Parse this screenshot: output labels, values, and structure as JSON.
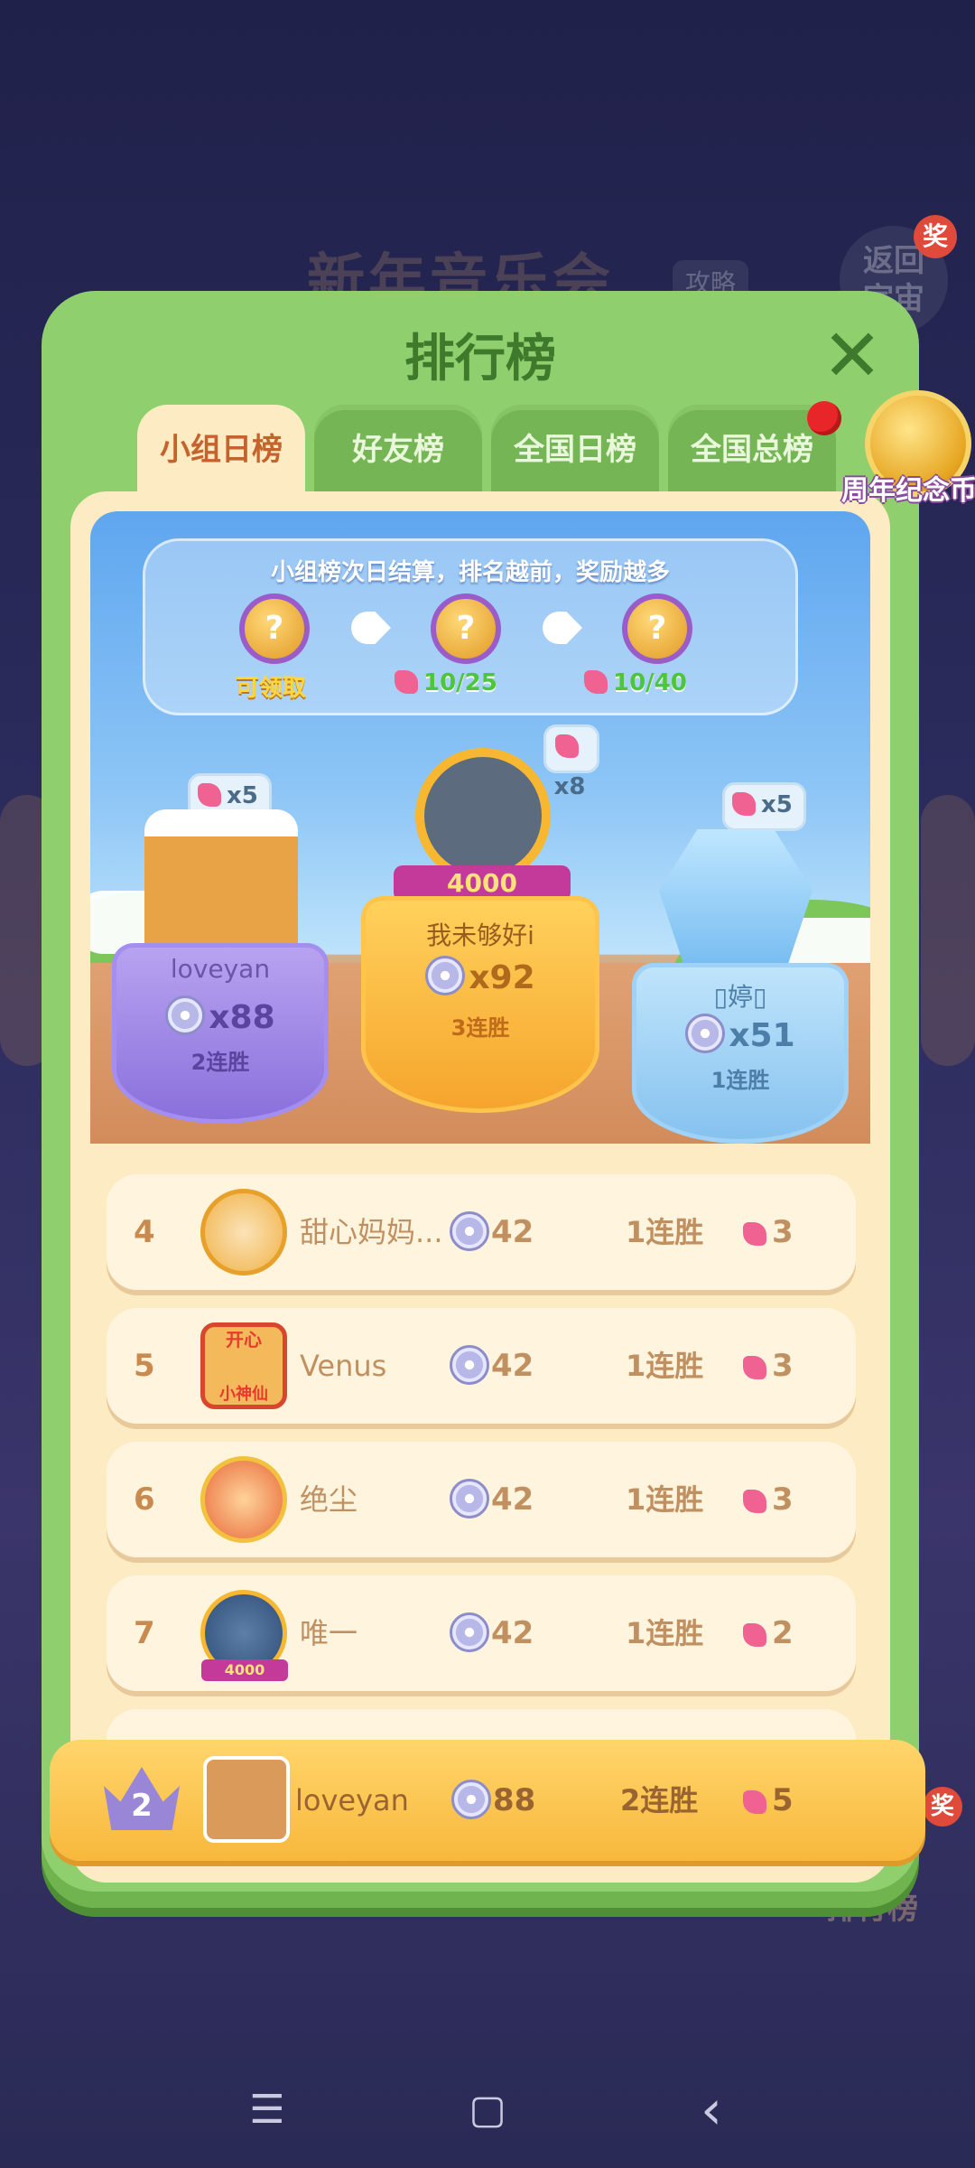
{
  "background": {
    "title": "新年音乐会",
    "guide_badge": "攻略",
    "return_button": "返回\n宇宙",
    "reward_tag": "奖",
    "rank_label": "排行榜"
  },
  "panel": {
    "title": "排行榜",
    "close_icon": "close-icon"
  },
  "tabs": [
    {
      "label": "小组日榜",
      "active": true
    },
    {
      "label": "好友榜",
      "active": false
    },
    {
      "label": "全国日榜",
      "active": false
    },
    {
      "label": "全国总榜",
      "active": false
    }
  ],
  "anniversary_coin": {
    "label": "周年纪念币"
  },
  "rules": {
    "text": "小组榜次日结算，排名越前，奖励越多",
    "rewards": [
      {
        "symbol": "?",
        "caption": "可领取"
      },
      {
        "symbol": "?",
        "caption": "10/25"
      },
      {
        "symbol": "?",
        "caption": "10/40"
      }
    ]
  },
  "podium": {
    "first": {
      "name": "我未够好i",
      "score": "x92",
      "streak": "3连胜",
      "flowers": "x8",
      "frame_number": "4000"
    },
    "second": {
      "name": "loveyan",
      "score": "x88",
      "streak": "2连胜",
      "flowers": "x5"
    },
    "third": {
      "name": "▯婷▯",
      "score": "x51",
      "streak": "1连胜",
      "flowers": "x5"
    }
  },
  "rows": [
    {
      "rank": "4",
      "name": "甜心妈妈...",
      "score": "42",
      "streak": "1连胜",
      "flowers": "3"
    },
    {
      "rank": "5",
      "name": "Venus",
      "score": "42",
      "streak": "1连胜",
      "flowers": "3",
      "badge_top": "开心",
      "badge_bottom": "小神仙"
    },
    {
      "rank": "6",
      "name": "绝尘",
      "score": "42",
      "streak": "1连胜",
      "flowers": "3"
    },
    {
      "rank": "7",
      "name": "唯一",
      "score": "42",
      "streak": "1连胜",
      "flowers": "2",
      "frame_number": "4000"
    }
  ],
  "my_rank": {
    "rank": "2",
    "name": "loveyan",
    "score": "88",
    "streak": "2连胜",
    "flowers": "5"
  },
  "navbar": {
    "menu": "☰",
    "home": "▢",
    "back": "‹"
  },
  "colors": {
    "panel_green": "#8fcf6d",
    "active_tab": "#fdebc4",
    "highlight_bar": "#ffd56b"
  }
}
